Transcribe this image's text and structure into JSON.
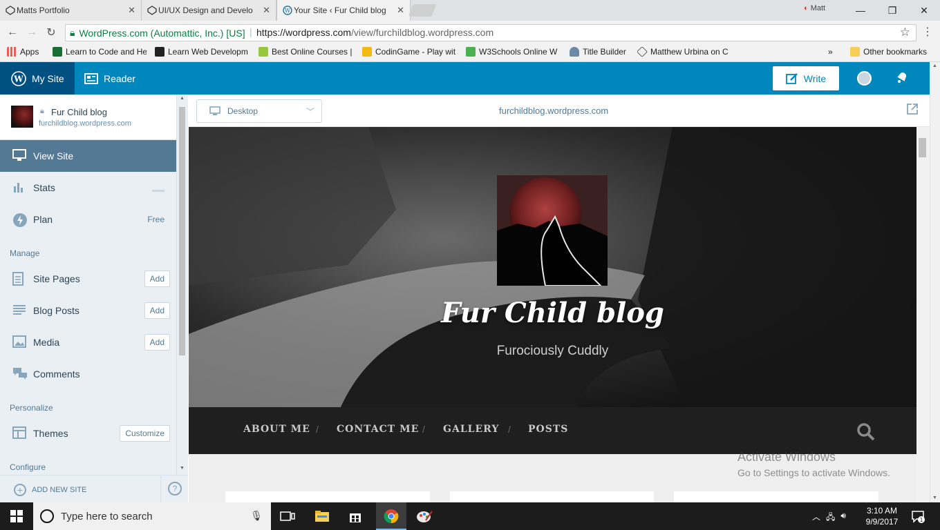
{
  "browser": {
    "tabs": [
      {
        "title": "Matts Portfolio",
        "active": false
      },
      {
        "title": "UI/UX Design and Develo",
        "active": false
      },
      {
        "title": "Your Site ‹ Fur Child blog",
        "active": true
      }
    ],
    "profile_name": "Matt",
    "window_controls": {
      "minimize": "—",
      "restore": "❐",
      "close": "✕"
    },
    "nav": {
      "back": "←",
      "forward": "→",
      "reload": "↻"
    },
    "security_label": "WordPress.com (Automattic, Inc.) [US]",
    "url_scheme_host": "https://wordpress.com",
    "url_path": "/view/furchildblog.wordpress.com",
    "bookmarks": [
      {
        "label": "Apps",
        "color": "#4285f4"
      },
      {
        "label": "Learn to Code and He",
        "color": "#1b9e3e"
      },
      {
        "label": "Learn Web Developm",
        "color": "#222222"
      },
      {
        "label": "Best Online Courses |",
        "color": "#97c83c"
      },
      {
        "label": "CodinGame - Play wit",
        "color": "#f2bb13"
      },
      {
        "label": "W3Schools Online W",
        "color": "#4caf50"
      },
      {
        "label": "Title Builder",
        "color": "#6b8ba4"
      },
      {
        "label": "Matthew Urbina on C",
        "color": "#333333"
      }
    ],
    "bookmarks_overflow": "»",
    "other_bookmarks": "Other bookmarks"
  },
  "masterbar": {
    "my_site": "My Site",
    "reader": "Reader",
    "write": "Write",
    "accent": "#0087be",
    "dark_accent": "#005082"
  },
  "sidebar": {
    "site_name": "Fur Child blog",
    "site_url": "furchildblog.wordpress.com",
    "items": [
      {
        "label": "View Site"
      },
      {
        "label": "Stats"
      },
      {
        "label": "Plan",
        "tag": "Free"
      }
    ],
    "sections": {
      "manage": "Manage",
      "personalize": "Personalize",
      "configure": "Configure"
    },
    "manage_items": [
      {
        "label": "Site Pages",
        "action": "Add"
      },
      {
        "label": "Blog Posts",
        "action": "Add"
      },
      {
        "label": "Media",
        "action": "Add"
      },
      {
        "label": "Comments"
      }
    ],
    "personalize_items": [
      {
        "label": "Themes",
        "action": "Customize"
      }
    ],
    "add_new_site": "ADD NEW SITE",
    "help": "?"
  },
  "preview": {
    "device": "Desktop",
    "url": "furchildblog.wordpress.com",
    "blog_title": "Fur Child blog",
    "tagline": "Furociously Cuddly",
    "nav": [
      "ABOUT ME",
      "CONTACT ME",
      "GALLERY",
      "POSTS"
    ],
    "nav_separator": "/"
  },
  "watermark": {
    "line1": "Activate Windows",
    "line2": "Go to Settings to activate Windows."
  },
  "taskbar": {
    "search_placeholder": "Type here to search",
    "time": "3:10 AM",
    "date": "9/9/2017",
    "notifications": "1"
  }
}
